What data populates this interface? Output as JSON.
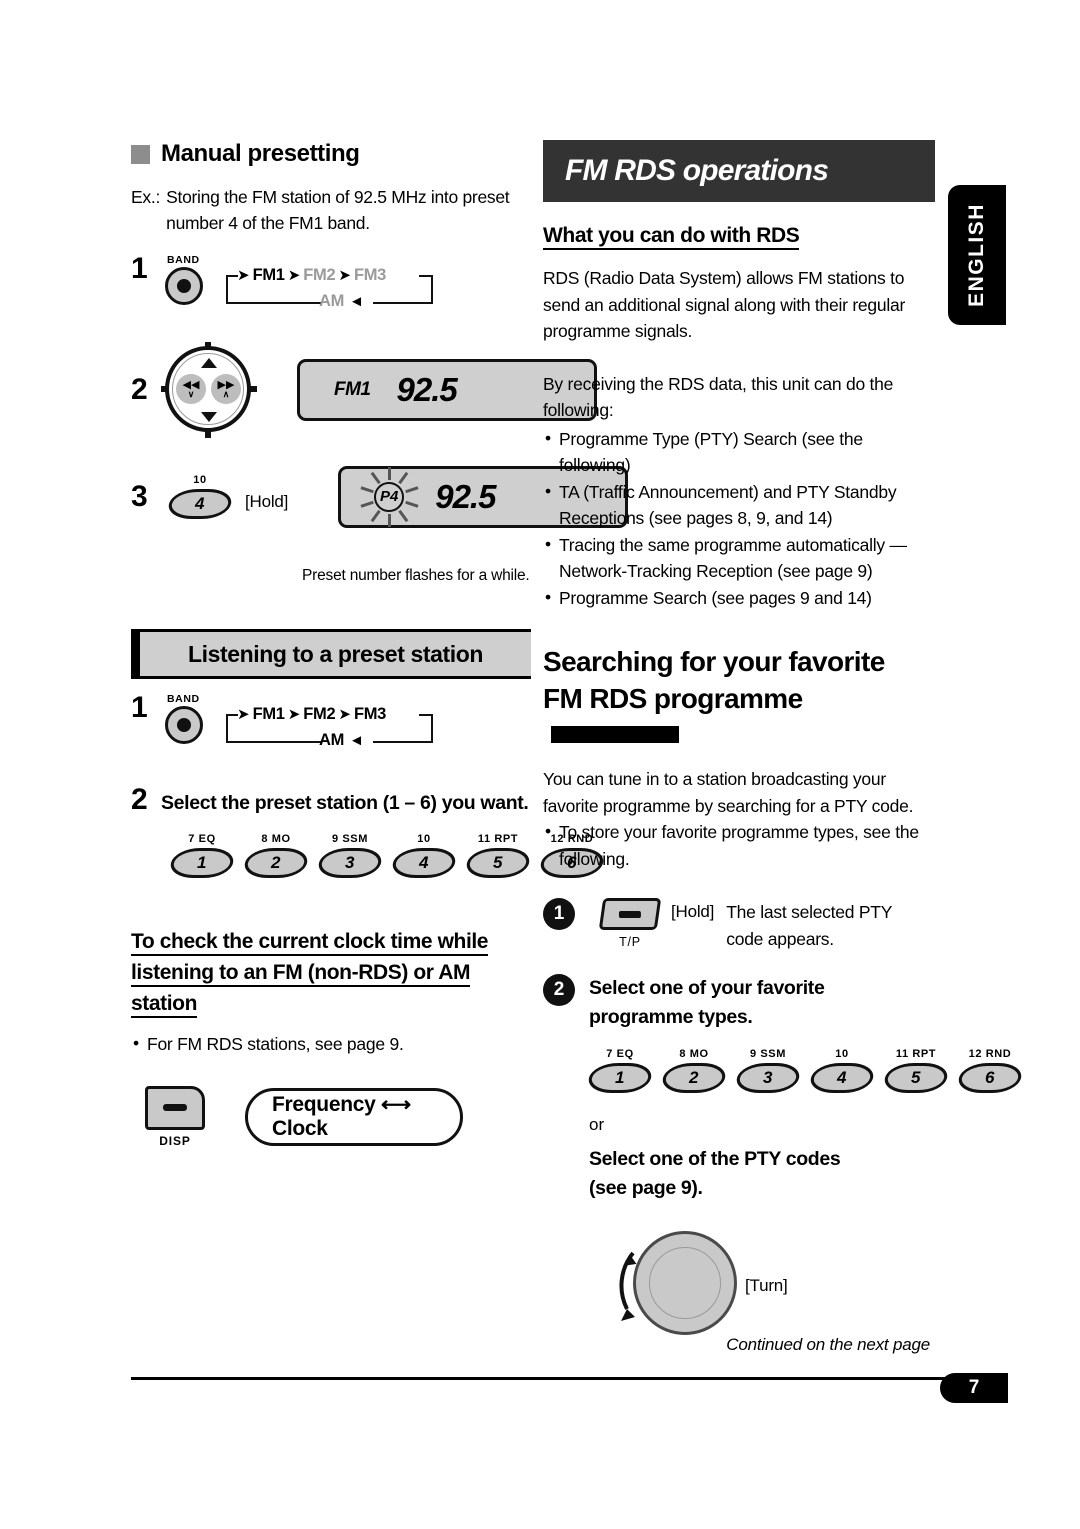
{
  "page": {
    "number": "7",
    "continued_note": "Continued on the next page",
    "side_tab": "ENGLISH"
  },
  "left": {
    "manual_presetting": {
      "heading": "Manual presetting",
      "example_label": "Ex.:",
      "example_text": "Storing the FM station of 92.5 MHz into preset number 4 of the FM1 band.",
      "step1": {
        "num": "1",
        "band_caption": "BAND",
        "flow": {
          "fm1": "FM1",
          "fm2": "FM2",
          "fm3": "FM3",
          "am": "AM"
        }
      },
      "step2": {
        "num": "2",
        "display": {
          "band": "FM1",
          "freq": "92.5"
        }
      },
      "step3": {
        "num": "3",
        "key_top_label": "10",
        "key_label": "4",
        "hold": "[Hold]",
        "display": {
          "preset": "P4",
          "freq": "92.5"
        },
        "caption": "Preset number flashes for a while."
      }
    },
    "listening": {
      "bar_title": "Listening to a preset station",
      "step1": {
        "num": "1",
        "band_caption": "BAND",
        "flow": {
          "fm1": "FM1",
          "fm2": "FM2",
          "fm3": "FM3",
          "am": "AM"
        }
      },
      "step2": {
        "num": "2",
        "text": "Select the preset station (1 – 6) you want."
      },
      "preset_keys": [
        {
          "top": "7  EQ",
          "num": "1"
        },
        {
          "top": "8  MO",
          "num": "2"
        },
        {
          "top": "9  SSM",
          "num": "3"
        },
        {
          "top": "10",
          "num": "4"
        },
        {
          "top": "11  RPT",
          "num": "5"
        },
        {
          "top": "12  RND",
          "num": "6"
        }
      ]
    },
    "clock_check": {
      "heading_line1": "To check the current clock time while",
      "heading_line2": "listening to an FM (non-RDS) or AM station",
      "bullet": "For FM RDS stations, see page 9.",
      "disp_caption": "DISP",
      "pill_text": "Frequency ⟷ Clock"
    }
  },
  "right": {
    "rds_operations": {
      "title": "FM RDS operations",
      "subhead": "What you can do with RDS",
      "paragraph1": "RDS (Radio Data System) allows FM stations to send an additional signal along with their regular programme signals.",
      "paragraph2": "By receiving the RDS data, this unit can do the following:",
      "bullets": [
        "Programme Type (PTY) Search (see the following)",
        "TA (Traffic Announcement) and PTY Standby Receptions (see pages 8, 9,  and 14)",
        "Tracing the same programme automatically —Network-Tracking Reception (see page 9)",
        "Programme Search (see pages 9 and 14)"
      ]
    },
    "searching": {
      "heading_line1": "Searching for your favorite",
      "heading_line2": "FM RDS programme",
      "paragraph": "You can tune in to a station broadcasting your favorite programme by searching for a PTY code.",
      "bullet": "To store your favorite programme types, see the following.",
      "step1": {
        "num": "1",
        "button_caption": "T/P",
        "hold": "[Hold]",
        "text": "The last selected PTY code appears."
      },
      "step2": {
        "num": "2",
        "text": "Select one of your favorite programme types."
      },
      "preset_keys": [
        {
          "top": "7  EQ",
          "num": "1"
        },
        {
          "top": "8  MO",
          "num": "2"
        },
        {
          "top": "9  SSM",
          "num": "3"
        },
        {
          "top": "10",
          "num": "4"
        },
        {
          "top": "11  RPT",
          "num": "5"
        },
        {
          "top": "12  RND",
          "num": "6"
        }
      ],
      "or_label": "or",
      "pty_codes_text": "Select one of the PTY codes (see page 9).",
      "turn_label": "[Turn]"
    }
  }
}
